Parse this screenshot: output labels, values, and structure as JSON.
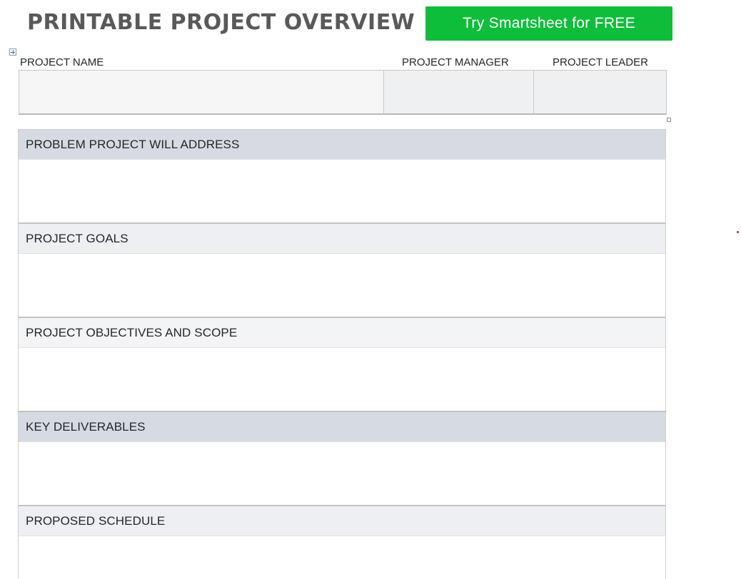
{
  "header": {
    "title": "PRINTABLE PROJECT OVERVIEW",
    "cta_label": "Try Smartsheet for FREE",
    "cta_color": "#0ebe3b"
  },
  "info_table": {
    "columns": [
      {
        "label": "PROJECT NAME",
        "value": ""
      },
      {
        "label": "PROJECT MANAGER",
        "value": ""
      },
      {
        "label": "PROJECT LEADER",
        "value": ""
      }
    ]
  },
  "sections": [
    {
      "title": "PROBLEM PROJECT WILL ADDRESS",
      "content": ""
    },
    {
      "title": "PROJECT GOALS",
      "content": ""
    },
    {
      "title": "PROJECT OBJECTIVES AND SCOPE",
      "content": ""
    },
    {
      "title": "KEY DELIVERABLES",
      "content": ""
    },
    {
      "title": "PROPOSED SCHEDULE",
      "content": ""
    }
  ],
  "icons": {
    "table_move_handle": "table-move-icon",
    "table_resize_handle": "table-resize-icon"
  }
}
